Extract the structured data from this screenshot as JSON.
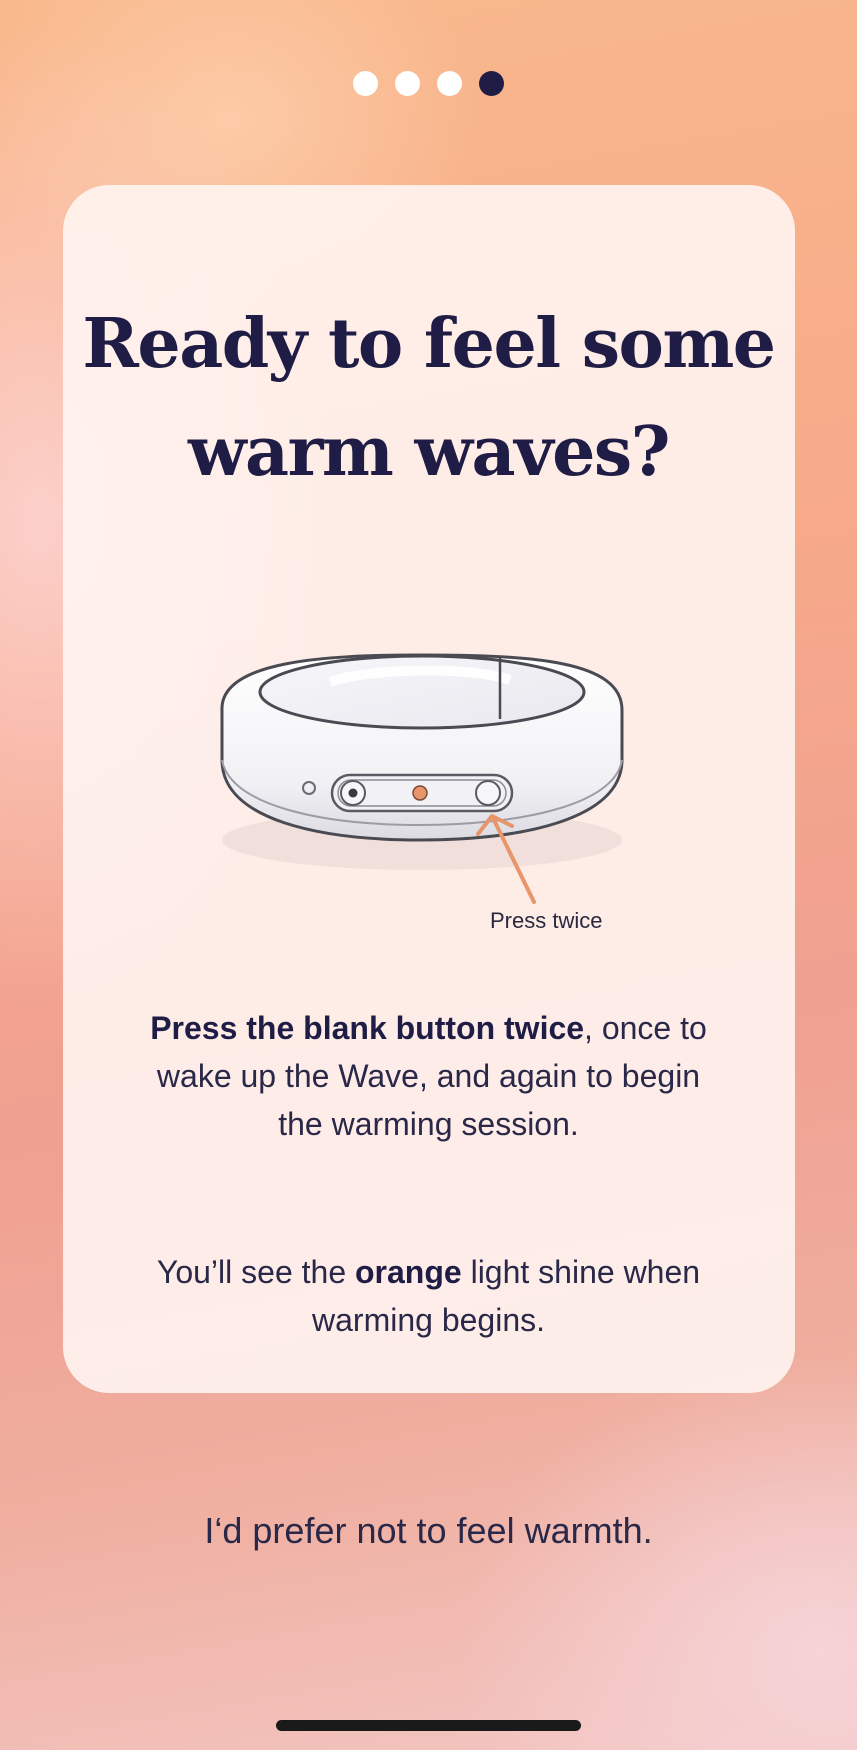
{
  "pager": {
    "total": 4,
    "active_index": 3
  },
  "heading": {
    "line1": "Ready to feel some",
    "line2": "warm waves?"
  },
  "illustration": {
    "arrow_label": "Press twice",
    "accent_color": "#e8956a"
  },
  "instructions": {
    "bold_part": "Press the blank button twice",
    "rest": ", once to wake up the Wave, and again to begin the warming session."
  },
  "note": {
    "before": "You’ll see the ",
    "bold": "orange",
    "after": " light shine when warming begins."
  },
  "decline_link": "I‘d prefer not to feel warmth.",
  "colors": {
    "primary": "#1f1d45",
    "accent": "#e8956a",
    "card": "#fff6f4"
  }
}
